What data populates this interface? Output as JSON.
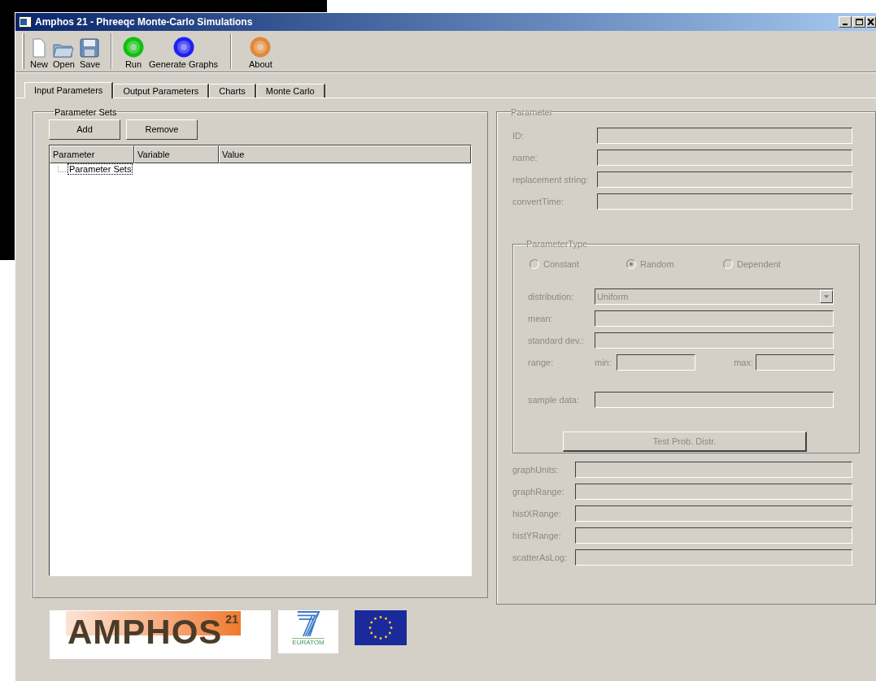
{
  "window": {
    "title": "Amphos 21 - Phreeqc Monte-Carlo Simulations"
  },
  "toolbar": [
    {
      "label": "New",
      "kind": "page"
    },
    {
      "label": "Open",
      "kind": "folder"
    },
    {
      "label": "Save",
      "kind": "disk"
    },
    {
      "label": "Run",
      "kind": "ball",
      "color": "#10c010"
    },
    {
      "label": "Generate Graphs",
      "kind": "ball",
      "color": "#2020f0"
    },
    {
      "label": "About",
      "kind": "ball",
      "color": "#e0883a"
    }
  ],
  "tabs": [
    {
      "label": "Input Parameters",
      "selected": true
    },
    {
      "label": "Output Parameters",
      "selected": false
    },
    {
      "label": "Charts",
      "selected": false
    },
    {
      "label": "Monte Carlo",
      "selected": false
    }
  ],
  "parameter_sets": {
    "title": "Parameter Sets",
    "buttons": [
      "Add",
      "Remove"
    ],
    "columns": [
      "Parameter",
      "Variable",
      "Value"
    ],
    "tree": [
      {
        "label": "Parameter Sets",
        "selected": true
      }
    ]
  },
  "parameter": {
    "title": "Parameter",
    "disabled": true,
    "fields": [
      {
        "label": "ID:"
      },
      {
        "label": "name:"
      },
      {
        "label": "replacement string:"
      },
      {
        "label": "convertTime:"
      }
    ],
    "parameter_type": {
      "title": "ParameterType",
      "options": [
        {
          "label": "Constant",
          "selected": false
        },
        {
          "label": "Random",
          "selected": true
        },
        {
          "label": "Dependent",
          "selected": false
        }
      ],
      "rows": [
        {
          "kind": "combo",
          "label": "distribution:",
          "value": "Uniform"
        },
        {
          "kind": "text",
          "label": "mean:"
        },
        {
          "kind": "text",
          "label": "standard dev.:"
        },
        {
          "kind": "range",
          "label": "range:",
          "min_label": "min:",
          "max_label": "max:"
        },
        {
          "kind": "text",
          "label": "sample data:"
        }
      ],
      "button": "Test Prob. Distr."
    },
    "graph_fields": [
      {
        "label": "graphUnits:"
      },
      {
        "label": "graphRange:"
      },
      {
        "label": "histXRange:"
      },
      {
        "label": "histYRange:"
      },
      {
        "label": "scatterAsLog:"
      }
    ]
  },
  "logos": {
    "amphos": {
      "name": "AMPHOS",
      "superscript": "21"
    },
    "euratom": "EURATOM"
  }
}
